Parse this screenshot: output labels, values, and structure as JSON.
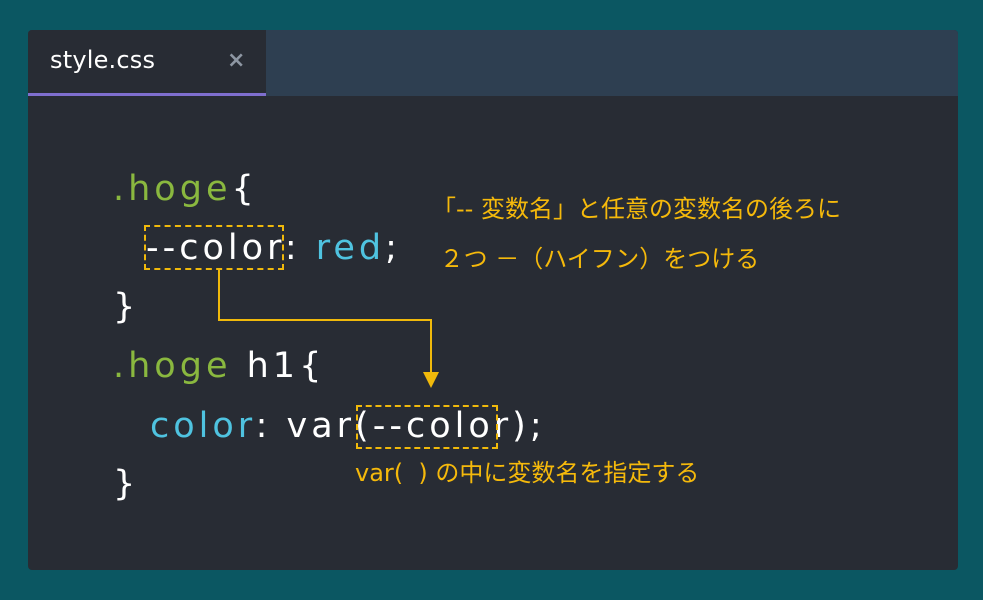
{
  "tab": {
    "title": "style.css",
    "close_icon": "close-icon",
    "close_glyph": "×"
  },
  "code": {
    "line1": {
      "selector": ".hoge",
      "brace": "{"
    },
    "line2": {
      "property": "--color",
      "colon": ":",
      "value": "red",
      "semicolon": ";"
    },
    "line3": {
      "brace": "}"
    },
    "line4": {
      "selector": ".hoge",
      "element": " h1",
      "brace": "{"
    },
    "line5": {
      "property": "color",
      "colon": ":",
      "func": " var(",
      "arg": "--color",
      "close": ");"
    },
    "line6": {
      "brace": "}"
    }
  },
  "annotations": {
    "note1_line1": "「-- 変数名」と任意の変数名の後ろに",
    "note1_line2": " ２つ －（ハイフン）をつける",
    "note2": "var(  ) の中に変数名を指定する"
  },
  "colors": {
    "background": "#0b5762",
    "editor": "#282c34",
    "tabbar": "#2e3f51",
    "tab_underline": "#7f6fcf",
    "selector": "#8ab83f",
    "property": "#4fc3e0",
    "annotation": "#f5b90b"
  }
}
